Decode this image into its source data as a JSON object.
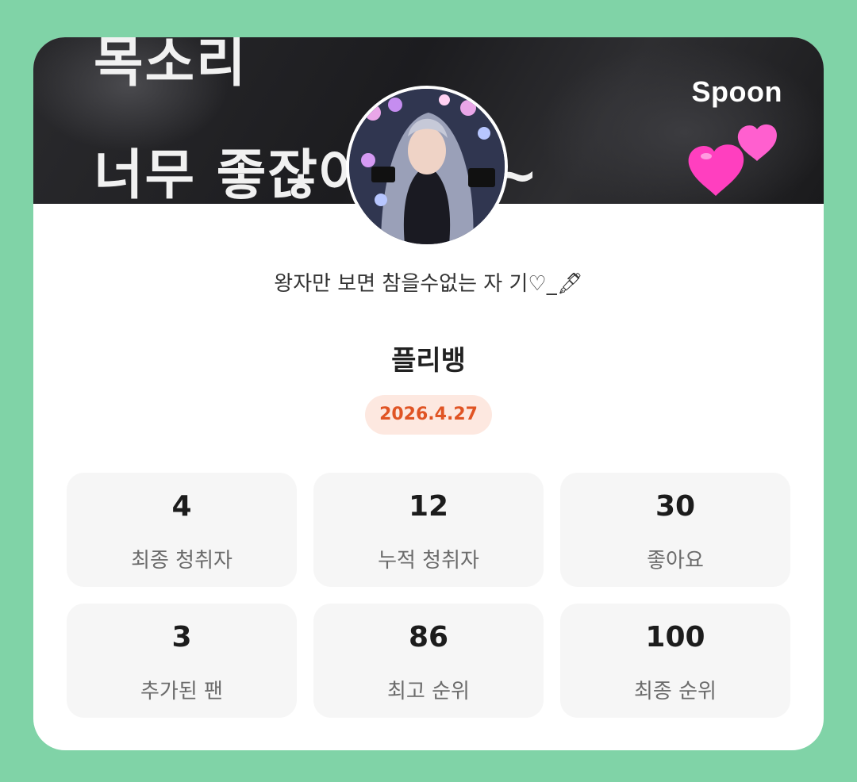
{
  "banner": {
    "line1": "목소리",
    "line2": "너무 좋잖아 쟈기~",
    "logo": "Spoon"
  },
  "profile": {
    "bio": "왕자만 보면 참을수없는 자 기♡_🖋",
    "name": "플리뱅",
    "date": "2026.4.27"
  },
  "stats": [
    {
      "value": "4",
      "label": "최종 청취자"
    },
    {
      "value": "12",
      "label": "누적 청취자"
    },
    {
      "value": "30",
      "label": "좋아요"
    },
    {
      "value": "3",
      "label": "추가된 팬"
    },
    {
      "value": "86",
      "label": "최고 순위"
    },
    {
      "value": "100",
      "label": "최종 순위"
    }
  ],
  "colors": {
    "background": "#80d3a7",
    "badge_text": "#e05424",
    "badge_bg": "#fde8e0",
    "heart": "#ff4fc4"
  },
  "icons": [
    "heart-icon",
    "avatar-image"
  ]
}
